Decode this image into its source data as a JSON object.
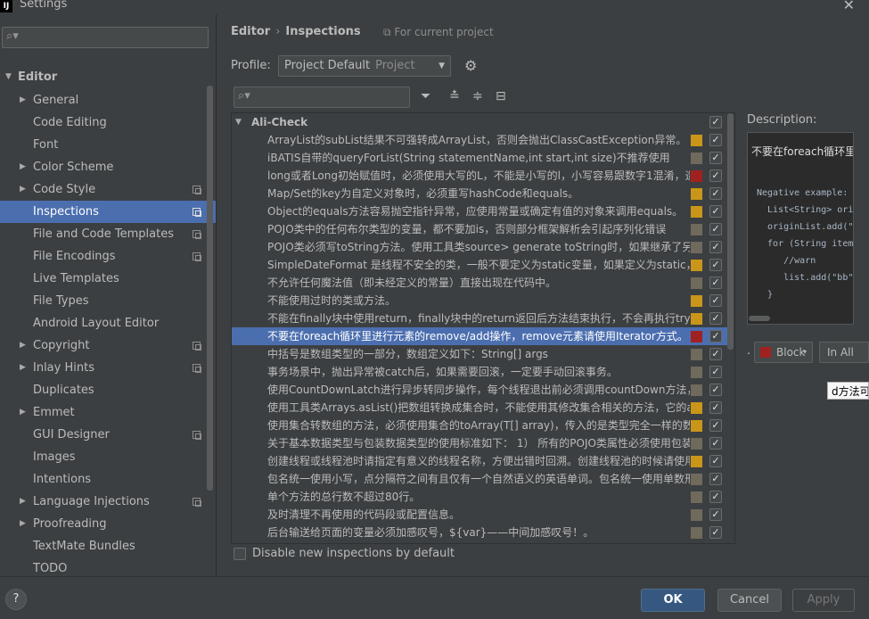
{
  "window": {
    "title": "Settings",
    "app_icon": "IJ",
    "close": "✕"
  },
  "colors": {
    "selection": "#4b6eaf",
    "warning": "#c9961a",
    "error": "#a12121",
    "weak": "#6f6a5c"
  },
  "sidebar": {
    "top_section": "Editor",
    "items": [
      {
        "label": "General",
        "expand": true,
        "copy": false
      },
      {
        "label": "Code Editing",
        "expand": false,
        "copy": false
      },
      {
        "label": "Font",
        "expand": false,
        "copy": false
      },
      {
        "label": "Color Scheme",
        "expand": true,
        "copy": false
      },
      {
        "label": "Code Style",
        "expand": true,
        "copy": true
      },
      {
        "label": "Inspections",
        "expand": false,
        "copy": true,
        "selected": true
      },
      {
        "label": "File and Code Templates",
        "expand": false,
        "copy": true
      },
      {
        "label": "File Encodings",
        "expand": false,
        "copy": true
      },
      {
        "label": "Live Templates",
        "expand": false,
        "copy": false
      },
      {
        "label": "File Types",
        "expand": false,
        "copy": false
      },
      {
        "label": "Android Layout Editor",
        "expand": false,
        "copy": false
      },
      {
        "label": "Copyright",
        "expand": true,
        "copy": true
      },
      {
        "label": "Inlay Hints",
        "expand": true,
        "copy": true
      },
      {
        "label": "Duplicates",
        "expand": false,
        "copy": false
      },
      {
        "label": "Emmet",
        "expand": true,
        "copy": false
      },
      {
        "label": "GUI Designer",
        "expand": false,
        "copy": true
      },
      {
        "label": "Images",
        "expand": false,
        "copy": false
      },
      {
        "label": "Intentions",
        "expand": false,
        "copy": false
      },
      {
        "label": "Language Injections",
        "expand": true,
        "copy": true
      },
      {
        "label": "Proofreading",
        "expand": true,
        "copy": false
      },
      {
        "label": "TextMate Bundles",
        "expand": false,
        "copy": false
      },
      {
        "label": "TODO",
        "expand": false,
        "copy": false
      }
    ]
  },
  "header": {
    "crumb1": "Editor",
    "sep": "›",
    "crumb2": "Inspections",
    "scope_note": "⧉ For current project"
  },
  "profile": {
    "label": "Profile:",
    "value": "Project Default",
    "value_muted": "Project"
  },
  "tree": {
    "group": "Ali-Check",
    "rows": [
      {
        "text": "ArrayList的subList结果不可强转成ArrayList，否则会抛出ClassCastException异常。",
        "sev": "warning"
      },
      {
        "text": "iBATIS自带的queryForList(String statementName,int start,int size)不推荐使用",
        "sev": "weak"
      },
      {
        "text": "long或者Long初始赋值时，必须使用大写的L，不能是小写的l，小写容易跟数字1混淆，造成误解",
        "sev": "error"
      },
      {
        "text": "Map/Set的key为自定义对象时，必须重写hashCode和equals。",
        "sev": "warning"
      },
      {
        "text": "Object的equals方法容易抛空指针异常，应使用常量或确定有值的对象来调用equals。",
        "sev": "warning"
      },
      {
        "text": "POJO类中的任何布尔类型的变量，都不要加is，否则部分框架解析会引起序列化错误",
        "sev": "weak"
      },
      {
        "text": "POJO类必须写toString方法。使用工具类source> generate toString时，如果继承了另一个POJO类",
        "sev": "weak"
      },
      {
        "text": "SimpleDateFormat 是线程不安全的类，一般不要定义为static变量，如果定义为static，必须加锁",
        "sev": "warning"
      },
      {
        "text": "不允许任何魔法值（即未经定义的常量）直接出现在代码中。",
        "sev": "weak"
      },
      {
        "text": "不能使用过时的类或方法。",
        "sev": "warning"
      },
      {
        "text": "不能在finally块中使用return，finally块中的return返回后方法结束执行，不会再执行try块中的return语句。",
        "sev": "warning"
      },
      {
        "text": "不要在foreach循环里进行元素的remove/add操作，remove元素请使用Iterator方式。",
        "sev": "error",
        "selected": true
      },
      {
        "text": "中括号是数组类型的一部分，数组定义如下：String[] args",
        "sev": "weak"
      },
      {
        "text": "事务场景中，抛出异常被catch后，如果需要回滚，一定要手动回滚事务。",
        "sev": "weak"
      },
      {
        "text": "使用CountDownLatch进行异步转同步操作，每个线程退出前必须调用countDown方法，线程执行代码注意catch异常，确保countDown方法可以执行",
        "sev": "weak"
      },
      {
        "text": "使用工具类Arrays.asList()把数组转换成集合时，不能使用其修改集合相关的方法，它的add/remove/clear方法会抛出异常",
        "sev": "warning"
      },
      {
        "text": "使用集合转数组的方法，必须使用集合的toArray(T[] array)，传入的是类型完全一样的数组",
        "sev": "warning"
      },
      {
        "text": "关于基本数据类型与包装数据类型的使用标准如下：  1） 所有的POJO类属性必须使用包装数据类型",
        "sev": "weak"
      },
      {
        "text": "创建线程或线程池时请指定有意义的线程名称，方便出错时回溯。创建线程池的时候请使用带ThreadFactory的构造函数",
        "sev": "warning"
      },
      {
        "text": "包名统一使用小写，点分隔符之间有且仅有一个自然语义的英语单词。包名统一使用单数形式",
        "sev": "weak"
      },
      {
        "text": "单个方法的总行数不超过80行。",
        "sev": "weak"
      },
      {
        "text": "及时清理不再使用的代码段或配置信息。",
        "sev": "weak"
      },
      {
        "text": "后台输送给页面的变量必须加感叹号，${var}——中间加感叹号！。",
        "sev": "weak"
      }
    ]
  },
  "description": {
    "label": "Description:",
    "summary": "不要在foreach循环里进行元素的remove/add操作",
    "code": "Negative example:\n  List<String> originList\n  originList.add(\"22\");\n  for (String item : originList)\n     //warn\n     list.add(\"bb\");\n  }"
  },
  "severity": {
    "value": "Block",
    "dd": "▾",
    "scope": "In All"
  },
  "tooltip": "d方法可以执行",
  "disable_label": "Disable new inspections by default",
  "buttons": {
    "ok": "OK",
    "cancel": "Cancel",
    "apply": "Apply",
    "help": "?"
  }
}
